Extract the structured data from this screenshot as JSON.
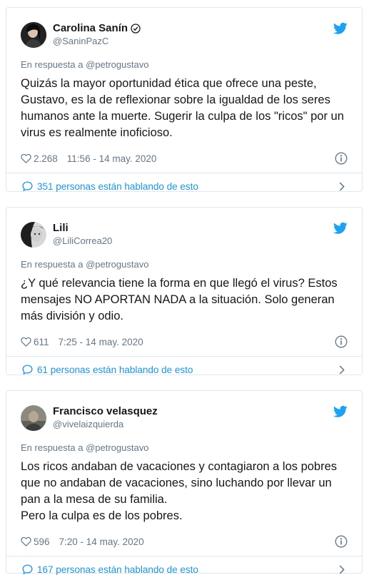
{
  "colors": {
    "twitter_blue": "#1da1f2",
    "link_blue": "#1b95e0",
    "muted_gray": "#657786",
    "border": "#e1e8ed"
  },
  "icons": {
    "bird": "twitter-bird-icon",
    "verified": "verified-badge-icon",
    "like": "heart-icon",
    "info": "info-icon",
    "conversation": "speech-bubble-icon",
    "chevron": "chevron-right-icon"
  },
  "tweets": [
    {
      "display_name": "Carolina Sanín",
      "handle": "@SaninPazC",
      "verified": true,
      "reply_prefix": "En respuesta a",
      "reply_to": "@petrogustavo",
      "text": "Quizás la mayor oportunidad ética que ofrece una peste, Gustavo, es la de reflexionar sobre la igualdad de los seres humanos ante la muerte. Sugerir la culpa de los \"ricos\" por un virus es realmente inoficioso.",
      "likes": "2.268",
      "timestamp": "11:56 - 14 may. 2020",
      "conversation": "351 personas están hablando de esto"
    },
    {
      "display_name": "Lili",
      "handle": "@LiliCorrea20",
      "verified": false,
      "reply_prefix": "En respuesta a",
      "reply_to": "@petrogustavo",
      "text": "¿Y qué relevancia tiene la forma en que llegó el virus? Estos mensajes NO APORTAN NADA a la situación. Solo generan más división y odio.",
      "likes": "611",
      "timestamp": "7:25 - 14 may. 2020",
      "conversation": "61 personas están hablando de esto"
    },
    {
      "display_name": "Francisco velasquez",
      "handle": "@vivelaizquierda",
      "verified": false,
      "reply_prefix": "En respuesta a",
      "reply_to": "@petrogustavo",
      "text": "Los ricos andaban de vacaciones y contagiaron a los pobres que no andaban de vacaciones, sino luchando por llevar un pan a la mesa de su familia.\nPero la culpa es de los pobres.",
      "likes": "596",
      "timestamp": "7:20 - 14 may. 2020",
      "conversation": "167 personas están hablando de esto"
    }
  ]
}
